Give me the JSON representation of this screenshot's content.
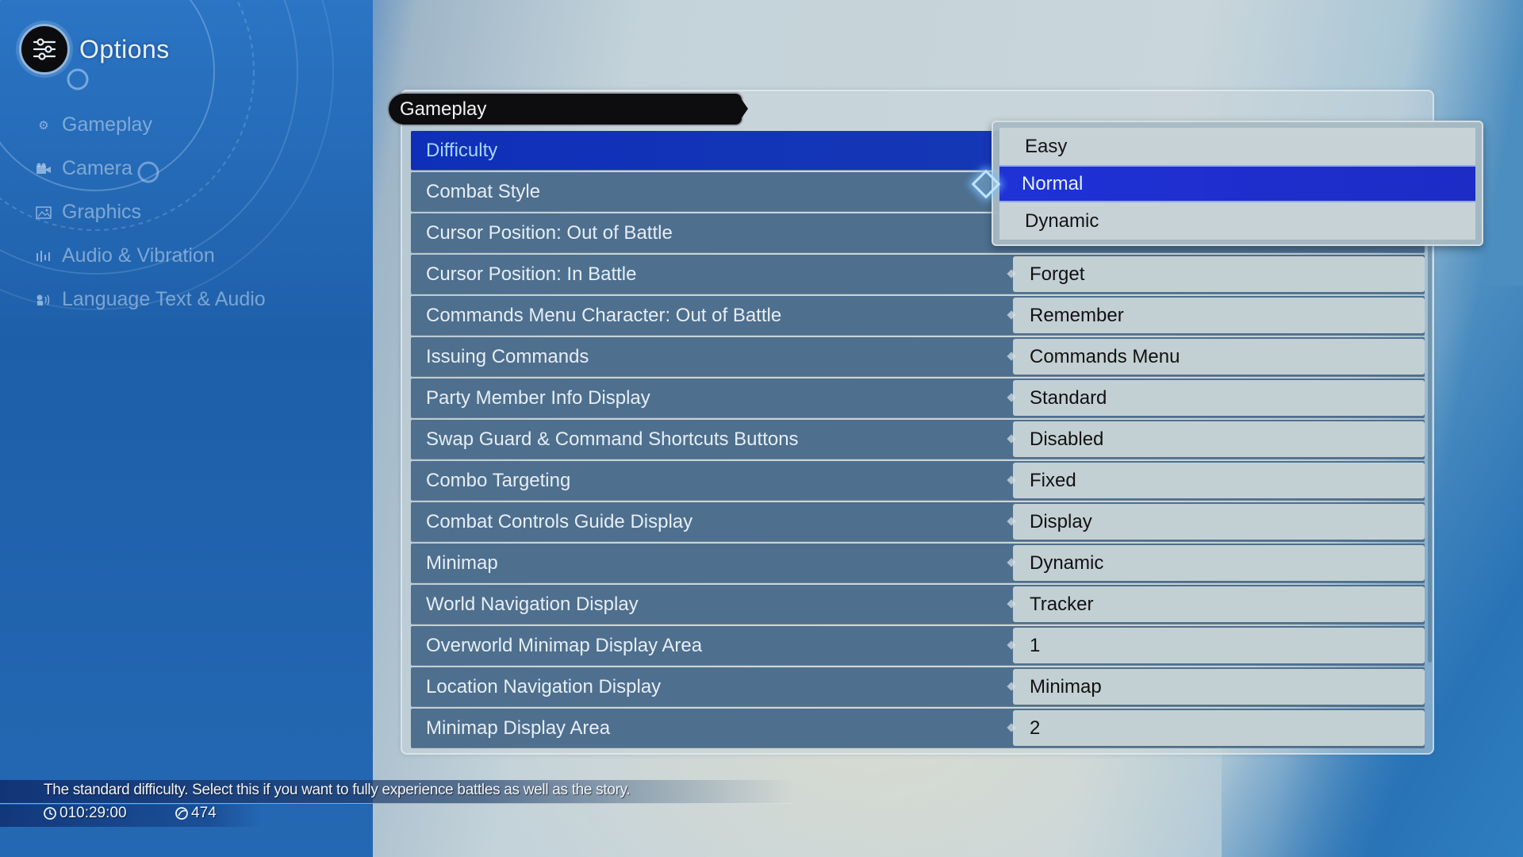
{
  "header": {
    "title": "Options",
    "icon": "sliders-icon"
  },
  "sidebar": {
    "items": [
      {
        "label": "Gameplay",
        "icon": "gears-icon"
      },
      {
        "label": "Camera",
        "icon": "camera-icon"
      },
      {
        "label": "Graphics",
        "icon": "image-icon"
      },
      {
        "label": "Audio & Vibration",
        "icon": "audio-bars-icon"
      },
      {
        "label": "Language Text & Audio",
        "icon": "speaker-person-icon"
      }
    ]
  },
  "panel": {
    "section_title": "Gameplay",
    "settings": [
      {
        "label": "Difficulty",
        "value": "Normal",
        "selected": true
      },
      {
        "label": "Combat Style",
        "value": ""
      },
      {
        "label": "Cursor Position: Out of Battle",
        "value": ""
      },
      {
        "label": "Cursor Position: In Battle",
        "value": "Forget"
      },
      {
        "label": "Commands Menu Character: Out of Battle",
        "value": "Remember"
      },
      {
        "label": "Issuing Commands",
        "value": "Commands Menu"
      },
      {
        "label": "Party Member Info Display",
        "value": "Standard"
      },
      {
        "label": "Swap Guard & Command Shortcuts Buttons",
        "value": "Disabled"
      },
      {
        "label": "Combo Targeting",
        "value": "Fixed"
      },
      {
        "label": "Combat Controls Guide Display",
        "value": "Display"
      },
      {
        "label": "Minimap",
        "value": "Dynamic"
      },
      {
        "label": "World Navigation Display",
        "value": "Tracker"
      },
      {
        "label": "Overworld Minimap Display Area",
        "value": "1"
      },
      {
        "label": "Location Navigation Display",
        "value": "Minimap"
      },
      {
        "label": "Minimap Display Area",
        "value": "2"
      }
    ]
  },
  "dropdown": {
    "for_setting": "Difficulty",
    "options": [
      "Easy",
      "Normal",
      "Dynamic"
    ],
    "highlighted": "Normal",
    "cursor_icon": "diamond-cursor-icon"
  },
  "footer": {
    "help_text": "The standard difficulty. Select this if you want to fully experience battles as well as the story.",
    "play_time": "010:29:00",
    "play_time_icon": "clock-icon",
    "currency": "474",
    "currency_icon": "gil-icon"
  },
  "colors": {
    "selected_row": "#1538b6",
    "selected_label": "#a8d7ff",
    "row_bg": "#4e6f8e",
    "value_bg": "#c3d0d3",
    "dropdown_active": "#1f2fd0"
  }
}
